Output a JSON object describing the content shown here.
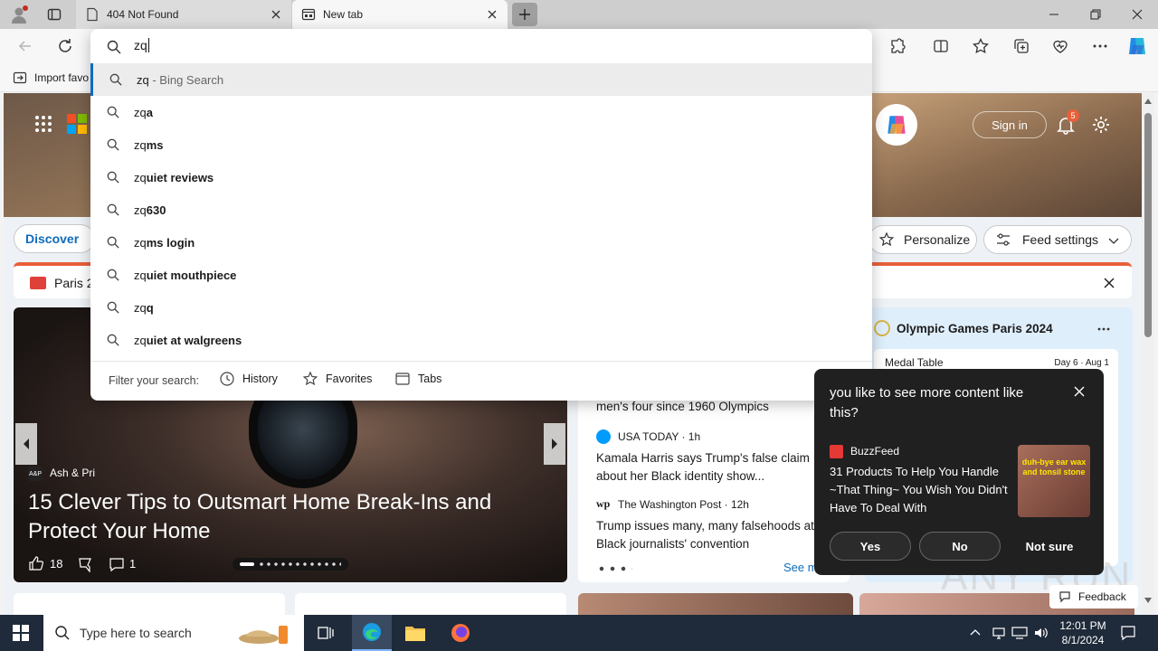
{
  "browser": {
    "tabs": [
      {
        "title": "404 Not Found"
      },
      {
        "title": "New tab"
      }
    ],
    "address_value": "zq",
    "favorites_bar": {
      "import_label": "Import favo"
    }
  },
  "omnibox": {
    "suggestions": [
      {
        "typed": "zq",
        "rest": "",
        "suffix": " - Bing Search"
      },
      {
        "typed": "zq",
        "rest": "a",
        "suffix": ""
      },
      {
        "typed": "zq",
        "rest": "ms",
        "suffix": ""
      },
      {
        "typed": "zq",
        "rest": "uiet reviews",
        "suffix": ""
      },
      {
        "typed": "zq",
        "rest": "630",
        "suffix": ""
      },
      {
        "typed": "zq",
        "rest": "ms login",
        "suffix": ""
      },
      {
        "typed": "zq",
        "rest": "uiet mouthpiece",
        "suffix": ""
      },
      {
        "typed": "zq",
        "rest": "q",
        "suffix": ""
      },
      {
        "typed": "zq",
        "rest": "uiet at walgreens",
        "suffix": ""
      }
    ],
    "filter_label": "Filter your search:",
    "filters": [
      "History",
      "Favorites",
      "Tabs"
    ]
  },
  "newtab": {
    "sign_in": "Sign in",
    "notification_count": "5",
    "discover_tab": "Discover",
    "personalize": "Personalize",
    "feed_settings": "Feed settings",
    "banner_text": "Paris 2",
    "hero_story": {
      "source": "Ash & Pri",
      "title": "15 Clever Tips to Outsmart Home Break-Ins and Protect Your Home",
      "likes": "18",
      "comments": "1"
    },
    "news": {
      "first_headline_tail": "men's four since 1960 Olympics",
      "items": [
        {
          "source": "USA TODAY · 1h",
          "headline": "Kamala Harris says Trump's false claim about her Black identity show..."
        },
        {
          "source": "The Washington Post · 12h",
          "headline": "Trump issues many, many falsehoods at Black journalists' convention"
        }
      ],
      "see_more": "See m"
    },
    "olympics": {
      "title": "Olympic Games Paris 2024",
      "medal_table": "Medal Table",
      "date": "Day 6 · Aug 1"
    },
    "feedback": "Feedback",
    "watermark": "ANY RUN"
  },
  "popup": {
    "question": "you like to see more content like this?",
    "source": "BuzzFeed",
    "headline": "31 Products To Help You Handle ~That Thing~ You Wish You Didn't Have To Deal With",
    "thumb_text": "duh-bye ear wax and tonsil stone",
    "buttons": [
      "Yes",
      "No",
      "Not sure"
    ]
  },
  "taskbar": {
    "search_placeholder": "Type here to search",
    "time": "12:01 PM",
    "date": "8/1/2024"
  },
  "colors": {
    "accent": "#0f6cbd",
    "edge_orange": "#e8603a"
  }
}
